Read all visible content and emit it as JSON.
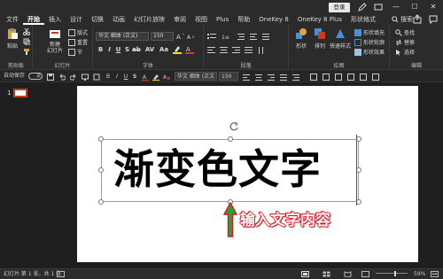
{
  "titlebar": {
    "login_label": "登录",
    "minimize_glyph": "—",
    "maximize_glyph": "☐",
    "close_glyph": "✕"
  },
  "tabs": [
    "文件",
    "开始",
    "插入",
    "设计",
    "切换",
    "动画",
    "幻灯片放映",
    "审阅",
    "视图",
    "Plus",
    "帮助",
    "OneKey 8",
    "OneKey 8 Plus",
    "形状格式"
  ],
  "active_tab": "开始",
  "search_label": "搜索",
  "ribbon": {
    "clipboard": {
      "label": "剪贴板",
      "paste": "粘贴"
    },
    "slides": {
      "label": "幻灯片",
      "new_slide": "新建\n幻灯片",
      "layout": "版式",
      "reset": "重置",
      "section": "节"
    },
    "font": {
      "label": "字体",
      "font_name": "华文 细体 (正文)",
      "font_size": "150"
    },
    "paragraph": {
      "label": "段落"
    },
    "drawing": {
      "label": "绘图",
      "shape": "形状",
      "arrange": "排列",
      "quick_styles": "快速样式",
      "fill": "形状填充",
      "outline": "形状轮廓",
      "effect": "形状效果"
    },
    "editing": {
      "label": "编辑",
      "find": "查找",
      "replace": "替换",
      "select": "选择"
    }
  },
  "qat": {
    "autosave": "自动保存",
    "autosave_state": "关",
    "font_name": "华文 细体 (正文",
    "font_size": "150"
  },
  "thumbnail": {
    "number": "1"
  },
  "slide": {
    "main_text": "渐变色文字",
    "annotation": "输入文字内容"
  },
  "status": {
    "slide_info": "幻灯片 第 1 张，共 1 张",
    "zoom": "59%"
  },
  "colors": {
    "accent_red": "#c43e1c",
    "arrow_green": "#2e9e3a",
    "annotation_outline": "#e0141e"
  }
}
